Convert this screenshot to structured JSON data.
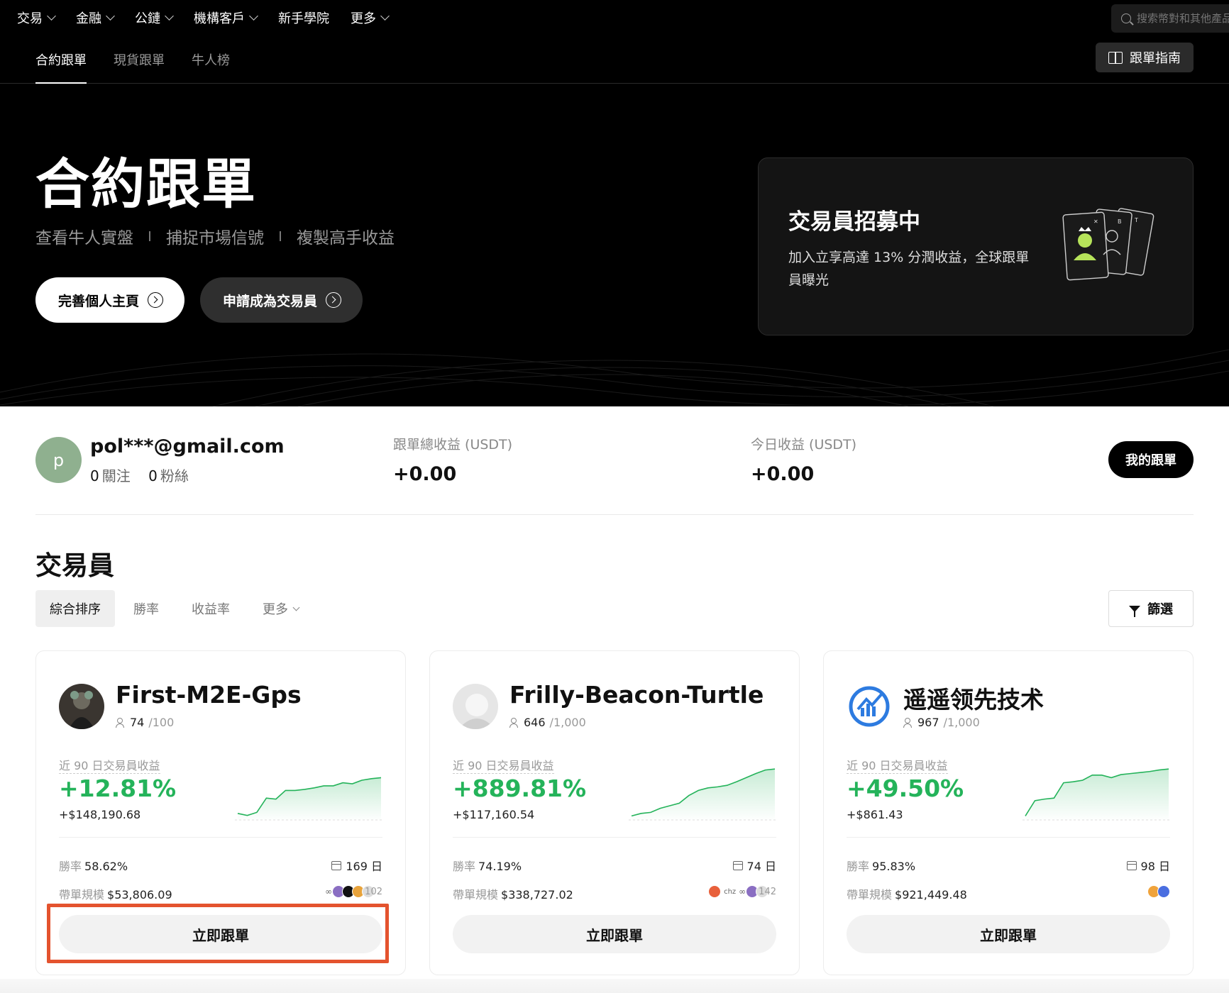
{
  "topnav": {
    "items": [
      {
        "label": "交易"
      },
      {
        "label": "金融"
      },
      {
        "label": "公鏈"
      },
      {
        "label": "機構客戶"
      },
      {
        "label": "新手學院",
        "no_chevron": true
      },
      {
        "label": "更多"
      }
    ],
    "search_placeholder": "搜索幣對和其他產品"
  },
  "subnav": {
    "tabs": [
      "合約跟單",
      "現貨跟單",
      "牛人榜"
    ],
    "active": 0,
    "guide_label": "跟單指南"
  },
  "hero": {
    "title": "合約跟單",
    "subtitle": [
      "查看牛人實盤",
      "捕捉市場信號",
      "複製高手收益"
    ],
    "btn_profile": "完善個人主頁",
    "btn_apply": "申請成為交易員"
  },
  "recruit": {
    "title": "交易員招募中",
    "desc": "加入立享高達 13% 分潤收益，全球跟單員曝光"
  },
  "user": {
    "avatar_letter": "p",
    "email": "pol***@gmail.com",
    "following_count": "0",
    "following_label": "關注",
    "fans_count": "0",
    "fans_label": "粉絲",
    "total_label": "跟單總收益 (USDT)",
    "total_value": "+0.00",
    "today_label": "今日收益 (USDT)",
    "today_value": "+0.00",
    "my_follow_label": "我的跟單"
  },
  "traders_section": {
    "title": "交易員",
    "sorts": [
      "綜合排序",
      "勝率",
      "收益率",
      "更多"
    ],
    "filter_label": "篩選"
  },
  "cards": [
    {
      "name": "First-M2E-Gps",
      "followers": "74",
      "capacity": "/100",
      "pnl_label": "近 90 日交易員收益",
      "pct": "+12.81%",
      "pnl": "+$148,190.68",
      "winrate_label": "勝率",
      "winrate": "58.62%",
      "days": "169 日",
      "aum_label": "帶單規模",
      "aum": "$53,806.09",
      "coin_extra": "102",
      "cta": "立即跟單",
      "spark": [
        0.1,
        0.06,
        0.12,
        0.4,
        0.38,
        0.55,
        0.55,
        0.57,
        0.6,
        0.64,
        0.64,
        0.7,
        0.68,
        0.75,
        0.78,
        0.8
      ]
    },
    {
      "name": "Frilly-Beacon-Turtle",
      "followers": "646",
      "capacity": "/1,000",
      "pnl_label": "近 90 日交易員收益",
      "pct": "+889.81%",
      "pnl": "+$117,160.54",
      "winrate_label": "勝率",
      "winrate": "74.19%",
      "days": "74 日",
      "aum_label": "帶單規模",
      "aum": "$338,727.02",
      "coin_extra": "142",
      "cta": "立即跟單",
      "spark": [
        0.05,
        0.1,
        0.12,
        0.2,
        0.25,
        0.3,
        0.45,
        0.55,
        0.6,
        0.62,
        0.65,
        0.72,
        0.8,
        0.88,
        0.95,
        0.97
      ]
    },
    {
      "name": "遥遥领先技术",
      "followers": "967",
      "capacity": "/1,000",
      "pnl_label": "近 90 日交易員收益",
      "pct": "+49.50%",
      "pnl": "+$861.43",
      "winrate_label": "勝率",
      "winrate": "95.83%",
      "days": "98 日",
      "aum_label": "帶單規模",
      "aum": "$921,449.48",
      "coin_extra": "",
      "cta": "立即跟單",
      "spark": [
        0.05,
        0.35,
        0.38,
        0.4,
        0.7,
        0.72,
        0.75,
        0.85,
        0.85,
        0.8,
        0.86,
        0.88,
        0.9,
        0.92,
        0.95,
        0.97
      ]
    }
  ],
  "colors": {
    "green": "#24b35a",
    "red": "#e4532e",
    "accent_dark": "#000000"
  }
}
